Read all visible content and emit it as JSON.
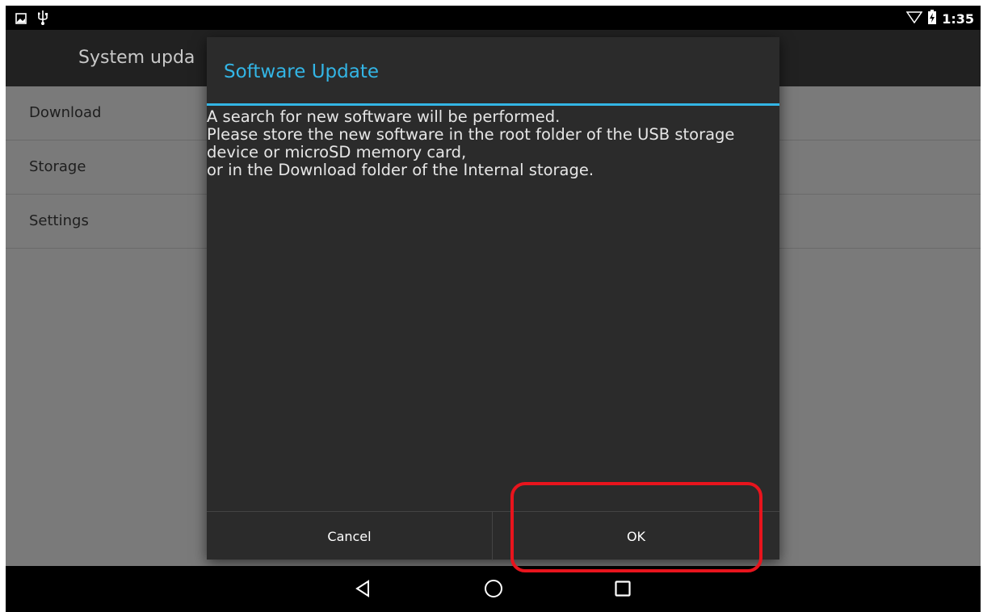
{
  "status_bar": {
    "left_icons": [
      "picture-notification-icon",
      "usb-icon"
    ],
    "right_icons": [
      "wifi-icon",
      "battery-charging-icon"
    ],
    "time": "1:35"
  },
  "action_bar": {
    "title": "System upda"
  },
  "list": {
    "items": [
      {
        "label": "Download"
      },
      {
        "label": "Storage"
      },
      {
        "label": "Settings"
      }
    ]
  },
  "dialog": {
    "title": "Software Update",
    "body_lines": [
      "A search for new software will be performed.",
      "Please store the new software in the root folder of the USB storage",
      "device or microSD memory card,",
      "or in the Download folder of the Internal storage."
    ],
    "cancel_label": "Cancel",
    "ok_label": "OK"
  },
  "nav_bar": {
    "icons": [
      "back-icon",
      "home-icon",
      "recents-icon"
    ]
  },
  "colors": {
    "accent": "#33b5e5",
    "highlight": "#e8141d",
    "dialog_bg": "#2b2b2b",
    "action_bar_bg": "#212121"
  }
}
